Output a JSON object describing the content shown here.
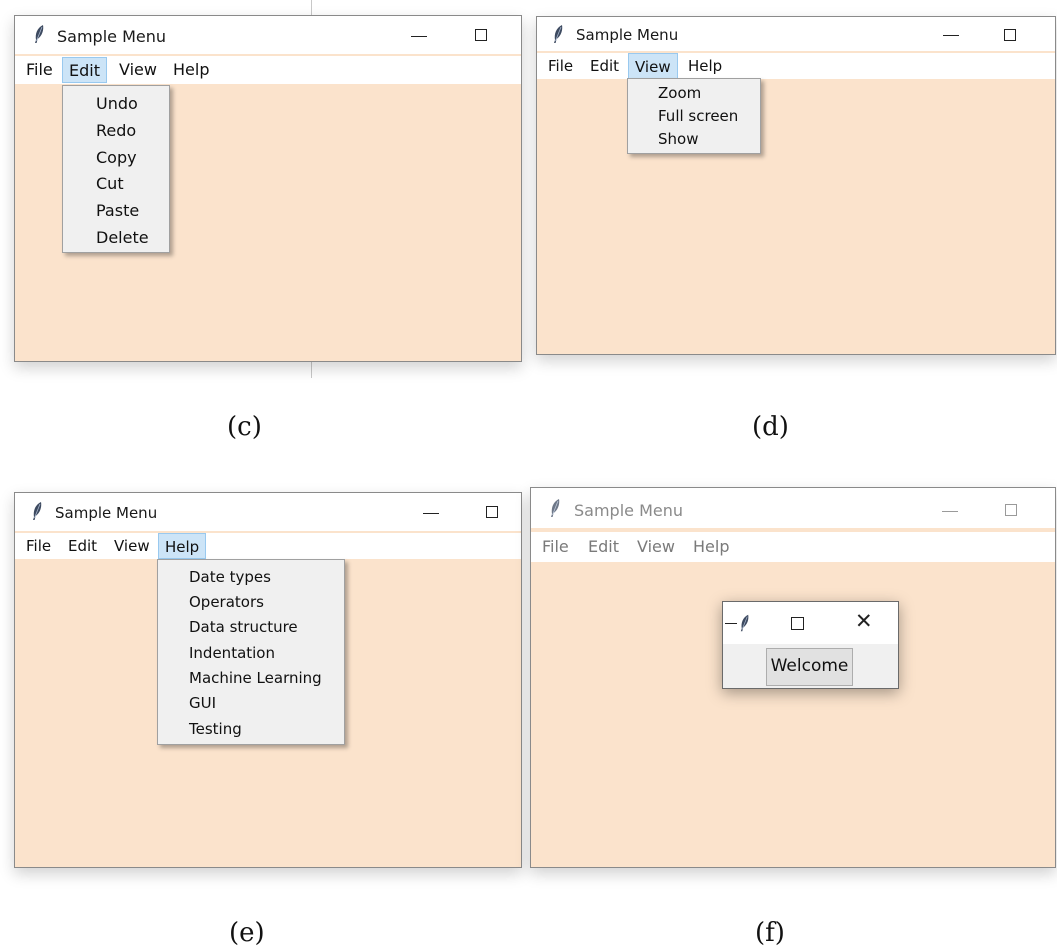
{
  "panels": {
    "c": {
      "window_title": "Sample Menu",
      "menu": [
        "File",
        "Edit",
        "View",
        "Help"
      ],
      "active_menu": "Edit",
      "dropdown_items": [
        "Undo",
        "Redo",
        "Copy",
        "Cut",
        "Paste",
        "Delete"
      ],
      "caption": "(c)"
    },
    "d": {
      "window_title": "Sample Menu",
      "menu": [
        "File",
        "Edit",
        "View",
        "Help"
      ],
      "active_menu": "View",
      "dropdown_items": [
        "Zoom",
        "Full screen",
        "Show"
      ],
      "caption": "(d)"
    },
    "e": {
      "window_title": "Sample Menu",
      "menu": [
        "File",
        "Edit",
        "View",
        "Help"
      ],
      "active_menu": "Help",
      "dropdown_items": [
        "Date types",
        "Operators",
        "Data structure",
        "Indentation",
        "Machine Learning",
        "GUI",
        "Testing"
      ],
      "caption": "(e)"
    },
    "f": {
      "window_title": "Sample Menu",
      "menu": [
        "File",
        "Edit",
        "View",
        "Help"
      ],
      "dialog_button": "Welcome",
      "caption": "(f)"
    }
  },
  "colors": {
    "client_background": "#fbe3cc",
    "menu_highlight": "#cce4f7",
    "dropdown_background": "#f0f0f0"
  },
  "icons": [
    "feather-icon",
    "minimize-icon",
    "maximize-icon",
    "close-icon"
  ]
}
